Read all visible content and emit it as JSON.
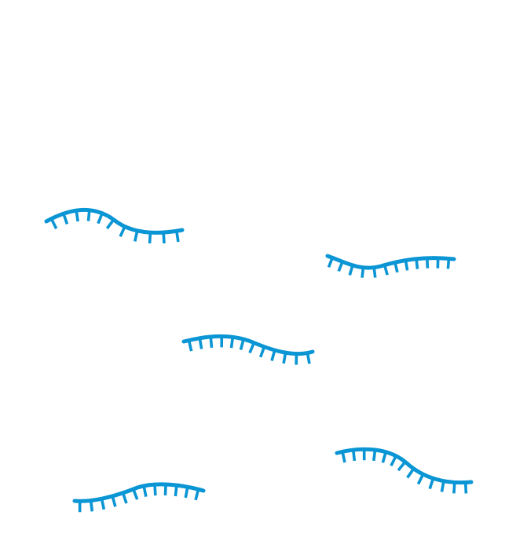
{
  "colors": {
    "background": "#ffffff",
    "strand": "#0a95d4"
  },
  "strands": [
    {
      "icon": "rna-strand-icon"
    },
    {
      "icon": "rna-strand-icon"
    },
    {
      "icon": "rna-strand-icon"
    },
    {
      "icon": "rna-strand-icon"
    },
    {
      "icon": "rna-strand-icon"
    }
  ]
}
